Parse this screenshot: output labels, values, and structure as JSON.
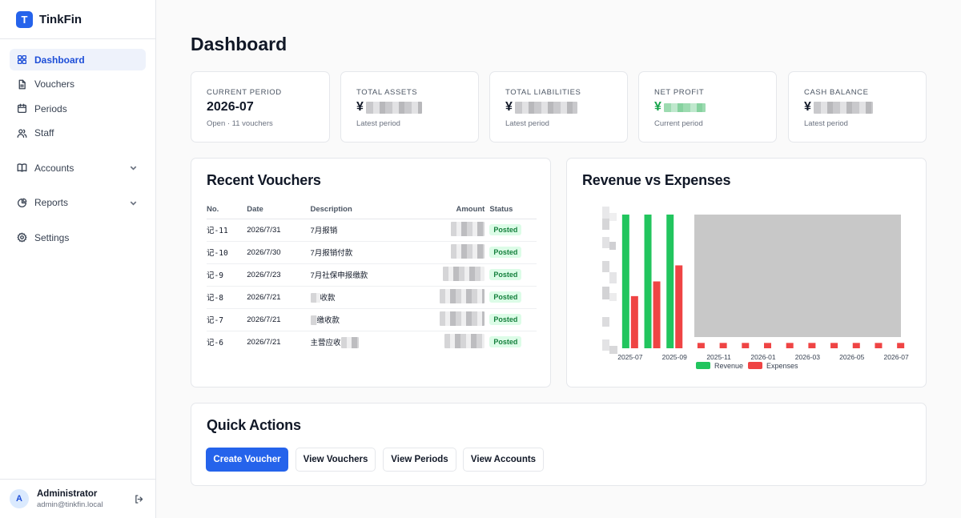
{
  "brand": {
    "logo_letter": "T",
    "name": "TinkFin",
    "accent": "#2563eb"
  },
  "sidebar": {
    "items": [
      {
        "label": "Dashboard",
        "icon": "grid-icon",
        "active": true
      },
      {
        "label": "Vouchers",
        "icon": "file-icon"
      },
      {
        "label": "Periods",
        "icon": "calendar-icon"
      },
      {
        "label": "Staff",
        "icon": "users-icon"
      },
      {
        "label": "Accounts",
        "icon": "book-icon",
        "expandable": true
      },
      {
        "label": "Reports",
        "icon": "pie-icon",
        "expandable": true
      },
      {
        "label": "Settings",
        "icon": "gear-icon"
      }
    ]
  },
  "user": {
    "initial": "A",
    "name": "Administrator",
    "email": "admin@tinkfin.local"
  },
  "page": {
    "title": "Dashboard"
  },
  "stats": [
    {
      "label": "Current Period",
      "value": "2026-07",
      "sub": "Open · 11 vouchers"
    },
    {
      "label": "Total Assets",
      "value": "¥",
      "sub": "Latest period"
    },
    {
      "label": "Total Liabilities",
      "value": "¥",
      "sub": "Latest period"
    },
    {
      "label": "Net Profit",
      "value": "¥",
      "sub": "Current period",
      "color": "#16a34a"
    },
    {
      "label": "Cash Balance",
      "value": "¥",
      "sub": "Latest period"
    }
  ],
  "vouchers": {
    "title": "Recent Vouchers",
    "columns": [
      "No.",
      "Date",
      "Description",
      "Amount",
      "Status"
    ],
    "rows": [
      {
        "no": "记-11",
        "date": "2026/7/31",
        "desc": "7月报销",
        "status": "Posted"
      },
      {
        "no": "记-10",
        "date": "2026/7/30",
        "desc": "7月报销付款",
        "status": "Posted"
      },
      {
        "no": "记-9",
        "date": "2026/7/23",
        "desc": "7月社保申报缴款",
        "status": "Posted"
      },
      {
        "no": "记-8",
        "date": "2026/7/21",
        "desc": "收款",
        "status": "Posted"
      },
      {
        "no": "记-7",
        "date": "2026/7/21",
        "desc": "缴收款",
        "status": "Posted"
      },
      {
        "no": "记-6",
        "date": "2026/7/21",
        "desc": "主营应收",
        "status": "Posted"
      }
    ]
  },
  "chart_data": {
    "type": "bar",
    "title": "Revenue vs Expenses",
    "categories": [
      "2025-07",
      "2025-08",
      "2025-09",
      "2025-10",
      "2025-11",
      "2025-12",
      "2026-01",
      "2026-02",
      "2026-03",
      "2026-04",
      "2026-05",
      "2026-06",
      "2026-07"
    ],
    "tick_labels": [
      "2025-07",
      "2025-09",
      "2025-11",
      "2026-01",
      "2026-03",
      "2026-05",
      "2026-07"
    ],
    "series": [
      {
        "name": "Revenue",
        "color": "#22c55e",
        "values": [
          100,
          100,
          100,
          0,
          0,
          0,
          0,
          0,
          0,
          0,
          0,
          0,
          0
        ]
      },
      {
        "name": "Expenses",
        "color": "#ef4444",
        "values": [
          39,
          50,
          62,
          4,
          4,
          4,
          4,
          4,
          4,
          4,
          4,
          4,
          4
        ]
      }
    ],
    "ylim": [
      0,
      100
    ],
    "legend": "bottom",
    "grid": false
  },
  "quick_actions": {
    "title": "Quick Actions",
    "buttons": [
      "Create Voucher",
      "View Vouchers",
      "View Periods",
      "View Accounts"
    ]
  }
}
